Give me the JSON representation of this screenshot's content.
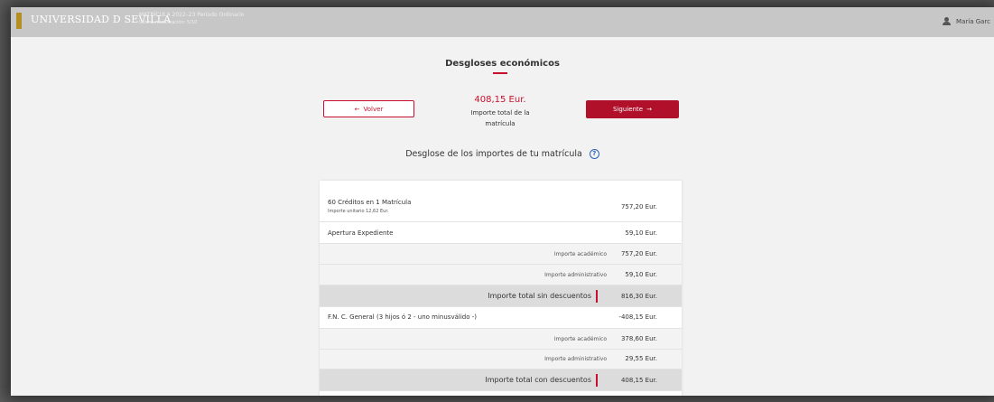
{
  "header": {
    "brand": "UNIVERSIDAD D SEVILLA",
    "subtitle_line1": "MATRÍCULA 2022–23 Período Ordinario",
    "subtitle_line2": "Última modificación: 5/10",
    "user_name": "María Garc"
  },
  "page": {
    "title": "Desgloses económicos",
    "back_label": "Volver",
    "next_label": "Siguiente",
    "total_amount": "408,15 Eur.",
    "total_label": "Importe total de la matrícula",
    "breakdown_title": "Desglose de los importes de tu matrícula"
  },
  "rows": {
    "r1": {
      "label": "60 Créditos en 1 Matrícula",
      "sub": "Importe unitario 12,62 Eur.",
      "amount": "757,20 Eur."
    },
    "r2": {
      "label": "Apertura Expediente",
      "amount": "59,10 Eur."
    },
    "r3": {
      "label": "Importe académico",
      "amount": "757,20 Eur."
    },
    "r4": {
      "label": "Importe administrativo",
      "amount": "59,10 Eur."
    },
    "r5": {
      "label": "Importe total sin descuentos",
      "amount": "816,30 Eur."
    },
    "r6": {
      "label": "F.N. C. General (3 hijos ó 2 - uno minusválido -)",
      "amount": "-408,15 Eur."
    },
    "r7": {
      "label": "Importe académico",
      "amount": "378,60 Eur."
    },
    "r8": {
      "label": "Importe administrativo",
      "amount": "29,55 Eur."
    },
    "r9": {
      "label": "Importe total con descuentos",
      "amount": "408,15 Eur."
    }
  },
  "colors": {
    "accent": "#c8102e",
    "help": "#2a62b8"
  },
  "icons": {
    "back": "arrow-left-icon",
    "next": "arrow-right-icon",
    "help": "question-circle-icon",
    "user": "user-icon"
  }
}
